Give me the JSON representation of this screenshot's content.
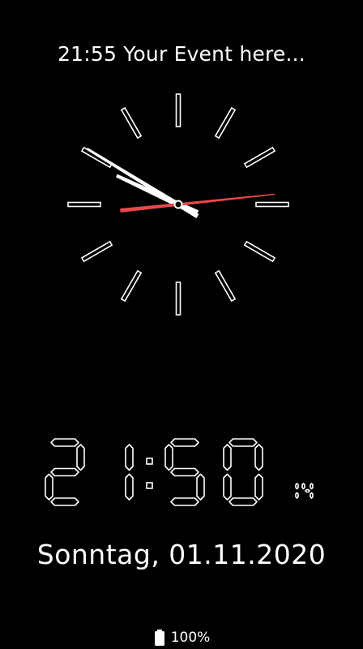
{
  "event": {
    "text": "21:55 Your Event here..."
  },
  "clock": {
    "hour": 21,
    "minute": 50,
    "second": 14,
    "hour_hand_color": "#ffffff",
    "minute_hand_color": "#ffffff",
    "second_hand_color": "#e8484c"
  },
  "digital_time": {
    "hours": "21",
    "minutes": "50",
    "seconds": "14"
  },
  "date": {
    "text": "Sonntag, 01.11.2020"
  },
  "battery": {
    "icon": "battery-full-icon",
    "text": "100%"
  }
}
